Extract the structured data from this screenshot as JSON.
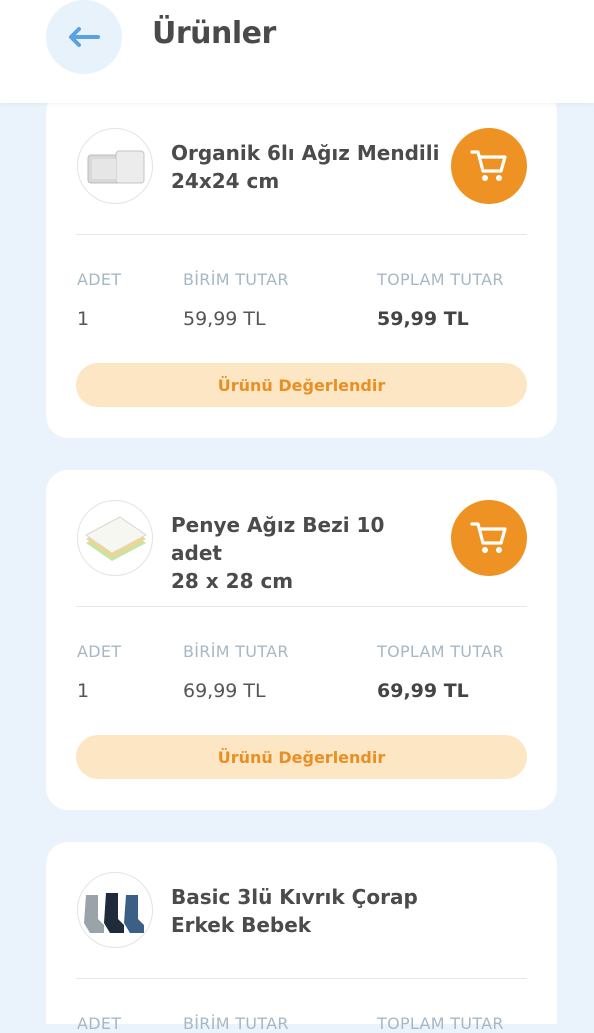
{
  "header": {
    "title": "Ürünler",
    "back_icon": "arrow-left-icon"
  },
  "products": [
    {
      "title_line1": "Organik 6lı Ağız Mendili",
      "title_line2": "24x24 cm",
      "qty_label": "ADET",
      "unit_label": "BİRİM TUTAR",
      "total_label": "TOPLAM TUTAR",
      "qty": "1",
      "unit_price": "59,99 TL",
      "total_price": "59,99 TL",
      "rate_label": "Ürünü Değerlendir"
    },
    {
      "title_line1": "Penye Ağız Bezi 10 adet",
      "title_line2": "28 x 28 cm",
      "qty_label": "ADET",
      "unit_label": "BİRİM TUTAR",
      "total_label": "TOPLAM TUTAR",
      "qty": "1",
      "unit_price": "69,99 TL",
      "total_price": "69,99 TL",
      "rate_label": "Ürünü Değerlendir"
    },
    {
      "title_line1": "Basic 3lü Kıvrık Çorap",
      "title_line2": "Erkek Bebek",
      "qty_label": "ADET",
      "unit_label": "BİRİM TUTAR",
      "total_label": "TOPLAM TUTAR"
    }
  ],
  "colors": {
    "accent": "#ee9223",
    "rate_button_bg": "#fde6c4",
    "background": "#eaf3fb"
  }
}
